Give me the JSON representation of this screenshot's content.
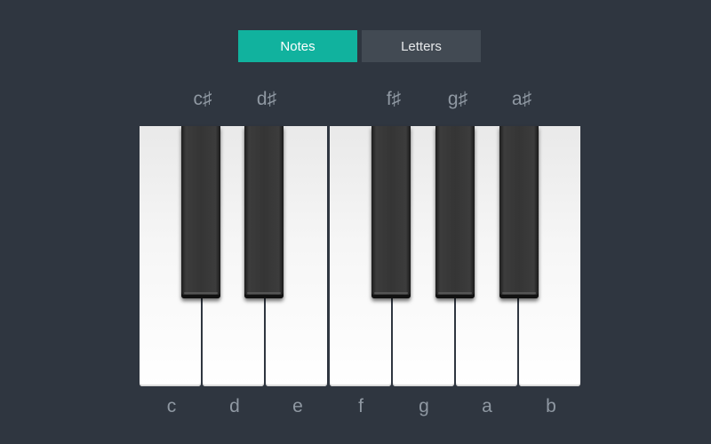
{
  "toggle": {
    "notes_label": "Notes",
    "letters_label": "Letters",
    "active": "Notes",
    "active_color": "#11b29e",
    "inactive_color": "#424a53"
  },
  "keyboard": {
    "black_keys": [
      {
        "label": "c♯"
      },
      {
        "label": "d♯"
      },
      {
        "label": "f♯"
      },
      {
        "label": "g♯"
      },
      {
        "label": "a♯"
      }
    ],
    "white_keys": [
      {
        "label": "c"
      },
      {
        "label": "d"
      },
      {
        "label": "e"
      },
      {
        "label": "f"
      },
      {
        "label": "g"
      },
      {
        "label": "a"
      },
      {
        "label": "b"
      }
    ]
  },
  "colors": {
    "background": "#2f3640",
    "label_text": "#8f98a2"
  }
}
